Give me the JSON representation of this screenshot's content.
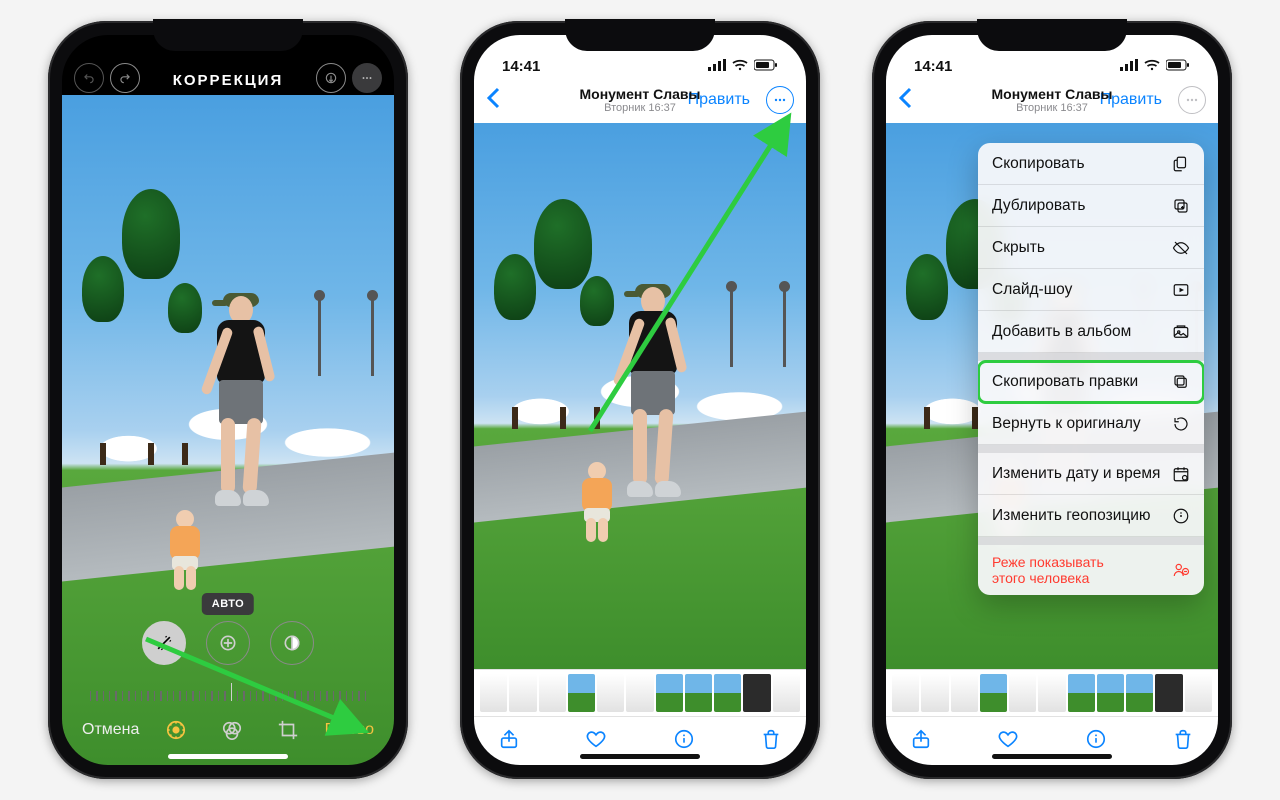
{
  "phone1": {
    "title": "КОРРЕКЦИЯ",
    "auto_tag": "АВТО",
    "cancel": "Отмена",
    "done": "Готово"
  },
  "phone2": {
    "time": "14:41",
    "location_title": "Монумент Славы",
    "subtitle": "Вторник  16:37",
    "edit_link": "Править"
  },
  "phone3": {
    "time": "14:41",
    "location_title": "Монумент Славы",
    "subtitle": "Вторник  16:37",
    "edit_link": "Править",
    "menu": {
      "copy": "Скопировать",
      "duplicate": "Дублировать",
      "hide": "Скрыть",
      "slideshow": "Слайд-шоу",
      "add_to_album": "Добавить в альбом",
      "copy_edits": "Скопировать правки",
      "revert": "Вернуть к оригиналу",
      "adjust_datetime": "Изменить дату и время",
      "adjust_location": "Изменить геопозицию",
      "feature_less": "Реже показывать\nэтого человека"
    }
  },
  "annotation_colors": {
    "arrow": "#2ecc40",
    "highlight": "#2ecc40"
  }
}
